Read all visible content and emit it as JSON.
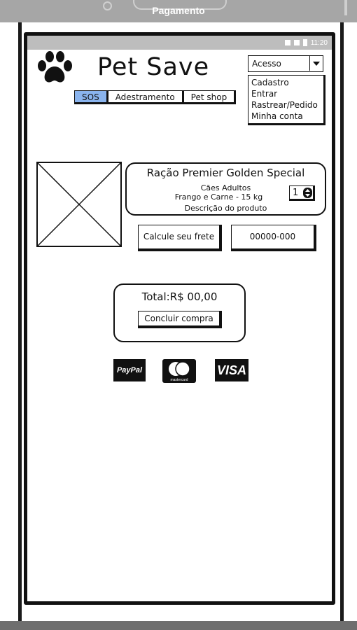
{
  "window": {
    "title": "Pagamento"
  },
  "status_bar": {
    "time": "11:20"
  },
  "header": {
    "brand": "Pet Save",
    "logo_icon": "paw-icon",
    "access_select": {
      "value": "Acesso",
      "options": [
        "Cadastro",
        "Entrar",
        "Rastrear/Pedido",
        "Minha conta"
      ]
    }
  },
  "nav": {
    "tabs": [
      {
        "label": "SOS",
        "active": true
      },
      {
        "label": "Adestramento",
        "active": false
      },
      {
        "label": "Pet shop",
        "active": false
      }
    ]
  },
  "product": {
    "image_icon": "image-placeholder-icon",
    "name": "Ração Premier Golden Special",
    "category": "Cães Adultos",
    "variant": "Frango e Carne - 15 kg",
    "description": "Descrição do produto",
    "quantity": "1"
  },
  "shipping": {
    "calc_label": "Calcule seu frete",
    "cep_value": "00000-000"
  },
  "checkout": {
    "total": "Total:R$ 00,00",
    "button_label": "Concluir compra"
  },
  "payment": {
    "methods": [
      {
        "name": "PayPal",
        "icon": "paypal-icon"
      },
      {
        "name": "mastercard",
        "icon": "mastercard-icon"
      },
      {
        "name": "VISA",
        "icon": "visa-icon"
      }
    ]
  },
  "colors": {
    "top_bar": "#a6a6a6",
    "active_tab": "#8ab4ee",
    "frame": "#111111"
  }
}
